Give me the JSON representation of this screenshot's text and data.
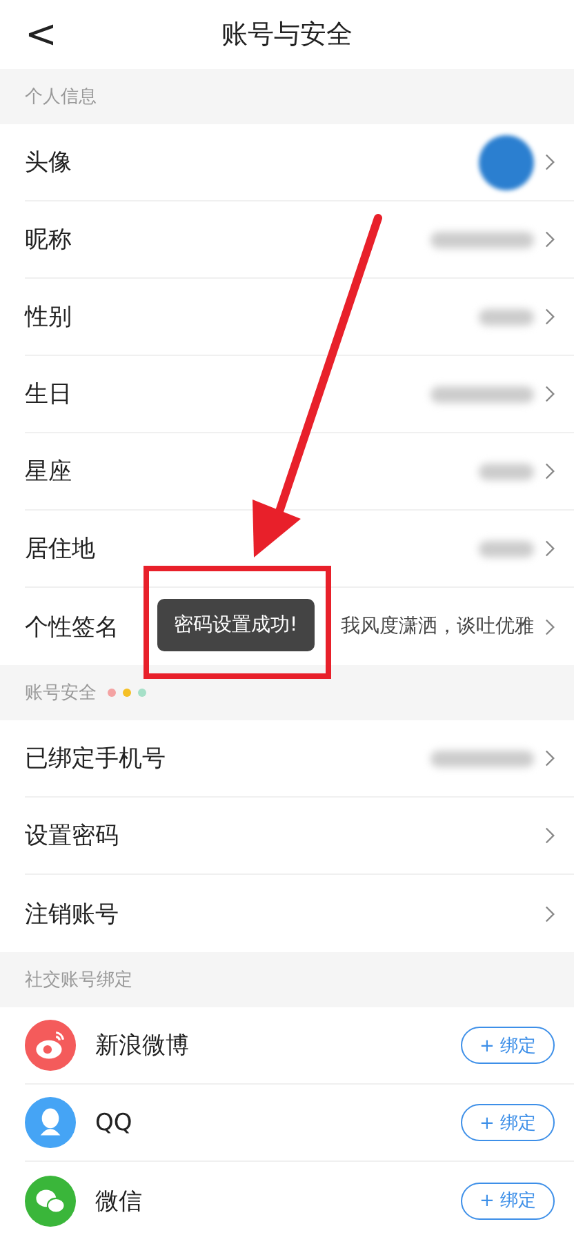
{
  "header": {
    "back": "<",
    "title": "账号与安全"
  },
  "sections": [
    {
      "title": "个人信息",
      "rows": [
        {
          "label": "头像",
          "value": {
            "kind": "avatar"
          }
        },
        {
          "label": "昵称",
          "value": {
            "kind": "blurred"
          }
        },
        {
          "label": "性别",
          "value": {
            "kind": "blurred_short"
          }
        },
        {
          "label": "生日",
          "value": {
            "kind": "blurred"
          }
        },
        {
          "label": "星座",
          "value": {
            "kind": "blurred_short"
          }
        },
        {
          "label": "居住地",
          "value": {
            "kind": "blurred_short"
          }
        },
        {
          "label": "个性签名",
          "value": {
            "kind": "text",
            "text": "我风度潇洒，谈吐优雅"
          }
        }
      ]
    },
    {
      "title": "账号安全",
      "dots": [
        {
          "color": "#f4a3a3"
        },
        {
          "color": "#f5c026"
        },
        {
          "color": "#a6e0c8"
        }
      ],
      "rows": [
        {
          "label": "已绑定手机号",
          "value": {
            "kind": "blurred"
          }
        },
        {
          "label": "设置密码",
          "value": {
            "kind": "none"
          }
        },
        {
          "label": "注销账号",
          "value": {
            "kind": "none"
          }
        }
      ]
    }
  ],
  "social": {
    "title": "社交账号绑定",
    "items": [
      {
        "name": "新浪微博",
        "kind": "weibo",
        "color": "#f45b5b",
        "button": "+ 绑定"
      },
      {
        "name": "QQ",
        "kind": "qq",
        "color": "#45a4f5",
        "button": "+ 绑定"
      },
      {
        "name": "微信",
        "kind": "wechat",
        "color": "#3ab63a",
        "button": "+ 绑定"
      }
    ]
  },
  "toast": {
    "text": "密码设置成功!"
  },
  "annotations": {
    "arrow": true,
    "highlight_box": true
  }
}
